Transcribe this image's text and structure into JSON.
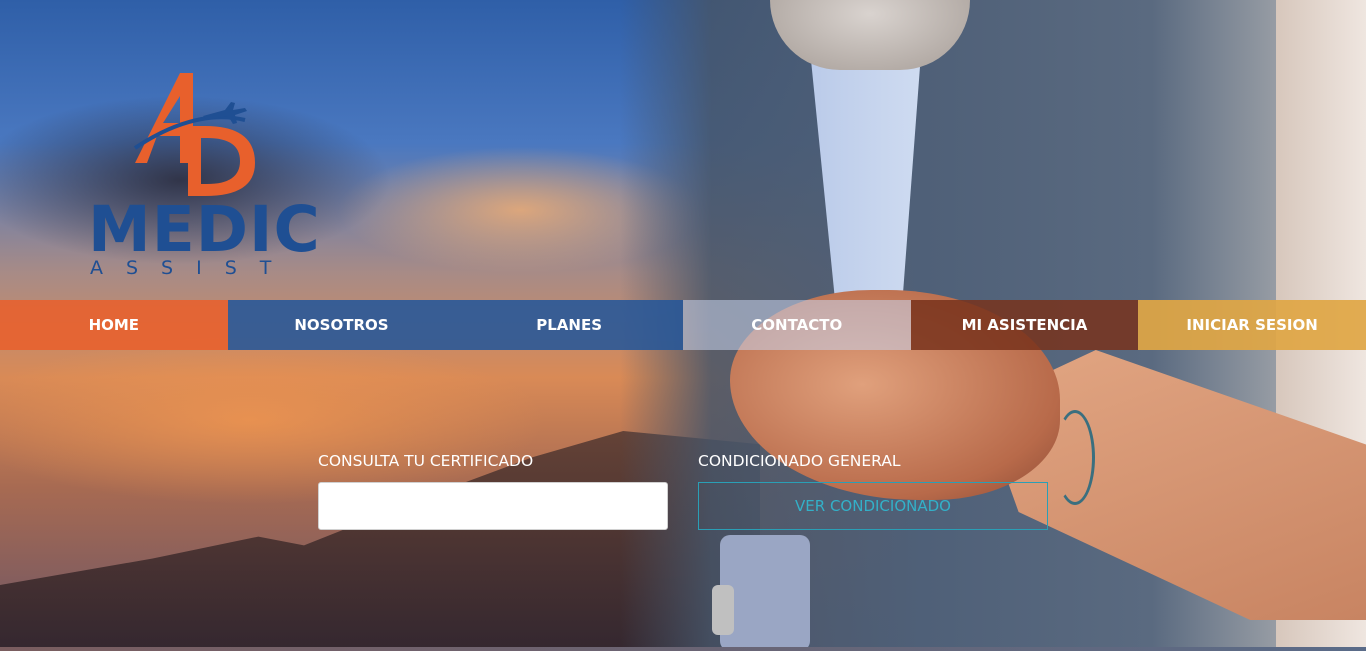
{
  "brand": {
    "name": "MEDIC",
    "tagline": "ASSIST",
    "colors": {
      "blue": "#1f4f93",
      "orange": "#e8602c"
    }
  },
  "nav": {
    "items": [
      {
        "label": "HOME",
        "color": "#e8602c"
      },
      {
        "label": "NOSOTROS",
        "color": "#265698"
      },
      {
        "label": "PLANES",
        "color": "#265698"
      },
      {
        "label": "CONTACTO",
        "color": "#c8d4ec"
      },
      {
        "label": "MI ASISTENCIA",
        "color": "#78321c"
      },
      {
        "label": "INICIAR SESION",
        "color": "#e0a644"
      }
    ]
  },
  "certificate": {
    "label": "CONSULTA TU CERTIFICADO",
    "value": "",
    "placeholder": ""
  },
  "conditions": {
    "label": "CONDICIONADO GENERAL",
    "button_label": "VER CONDICIONADO",
    "button_color": "#33b0c8"
  }
}
